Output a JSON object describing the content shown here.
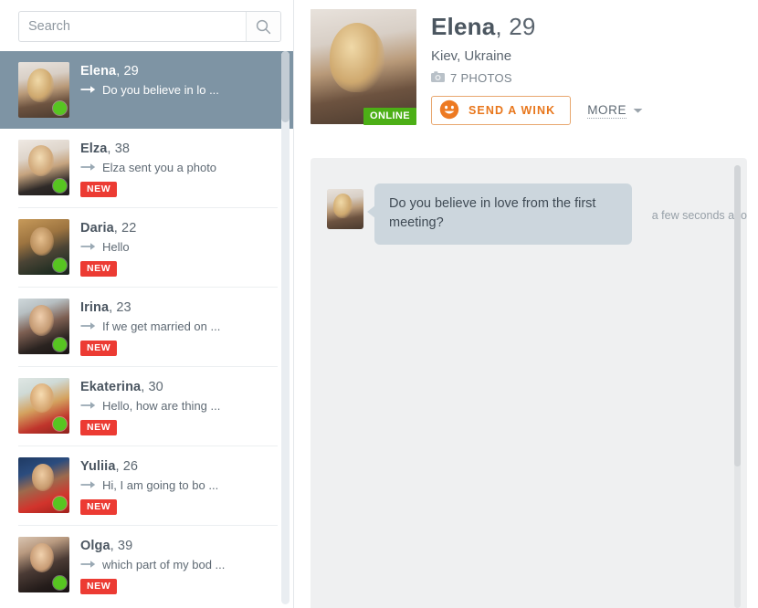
{
  "search": {
    "placeholder": "Search",
    "value": "",
    "icon": "search-icon"
  },
  "sidebar": {
    "conversations": [
      {
        "name": "Elena",
        "age": "29",
        "snippet": "Do you believe in lo ...",
        "badge": "",
        "online": true,
        "selected": true,
        "portrait": "p-elena"
      },
      {
        "name": "Elza",
        "age": "38",
        "snippet": "Elza sent you a photo",
        "badge": "NEW",
        "online": true,
        "selected": false,
        "portrait": "p-elza"
      },
      {
        "name": "Daria",
        "age": "22",
        "snippet": "Hello",
        "badge": "NEW",
        "online": true,
        "selected": false,
        "portrait": "p-daria"
      },
      {
        "name": "Irina",
        "age": "23",
        "snippet": "If we get married on ...",
        "badge": "NEW",
        "online": true,
        "selected": false,
        "portrait": "p-irina"
      },
      {
        "name": "Ekaterina",
        "age": "30",
        "snippet": "Hello, how are thing ...",
        "badge": "NEW",
        "online": true,
        "selected": false,
        "portrait": "p-ekaterina"
      },
      {
        "name": "Yuliia",
        "age": "26",
        "snippet": "Hi, I am going to bo ...",
        "badge": "NEW",
        "online": true,
        "selected": false,
        "portrait": "p-yuliia"
      },
      {
        "name": "Olga",
        "age": "39",
        "snippet": "which part of my bod ...",
        "badge": "NEW",
        "online": true,
        "selected": false,
        "portrait": "p-olga"
      }
    ]
  },
  "profile": {
    "name": "Elena",
    "age": "29",
    "location": "Kiev, Ukraine",
    "photos_label": "7 PHOTOS",
    "photos_count": 7,
    "online_label": "ONLINE",
    "wink_label": "SEND A WINK",
    "more_label": "MORE",
    "portrait": "p-elena"
  },
  "chat": {
    "messages": [
      {
        "text": "Do you believe in love from the first meeting?",
        "time": "a few seconds ago",
        "portrait": "p-elena"
      }
    ]
  },
  "colors": {
    "accent_orange": "#e8761b",
    "badge_red": "#ec3b33",
    "online_green": "#4caf16",
    "dot_green": "#57c521",
    "selected_row": "#7e94a4",
    "bubble": "#ccd6dd",
    "chat_bg": "#eff0f1"
  }
}
